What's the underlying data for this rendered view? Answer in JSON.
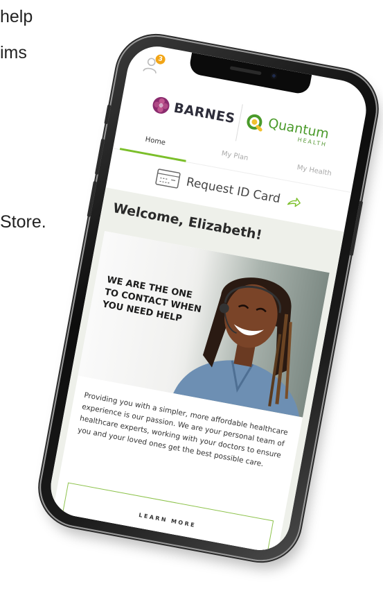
{
  "background_text": {
    "line1": "help",
    "line2": "ims",
    "line3": "Store."
  },
  "status": {
    "notification_count": "3"
  },
  "header": {
    "brand_left": "BARNES",
    "brand_right": "Quantum",
    "brand_right_sub": "HEALTH"
  },
  "tabs": [
    {
      "label": "Home",
      "active": true
    },
    {
      "label": "My Plan",
      "active": false
    },
    {
      "label": "My Health",
      "active": false
    }
  ],
  "request": {
    "label": "Request ID Card"
  },
  "main": {
    "welcome": "Welcome, Elizabeth!",
    "hero_lines": [
      "WE ARE THE ONE",
      "TO CONTACT WHEN",
      "YOU NEED HELP"
    ],
    "body": "Providing you with a simpler, more affordable healthcare experience is our passion. We are your personal team of healthcare experts, working with your doctors to ensure you and your loved ones get the best possible care.",
    "cta": "LEARN MORE"
  },
  "colors": {
    "accent_green": "#7bbf2a",
    "badge_orange": "#f2a516",
    "barnes_purple": "#8a2b6e",
    "content_bg": "#eef0ea"
  },
  "icons": {
    "profile": "user-icon",
    "badge": "notification-badge",
    "barnes_logo": "barnes-flower-icon",
    "quantum_logo": "quantum-q-icon",
    "id_card": "id-card-icon",
    "share": "share-arrow-icon"
  }
}
